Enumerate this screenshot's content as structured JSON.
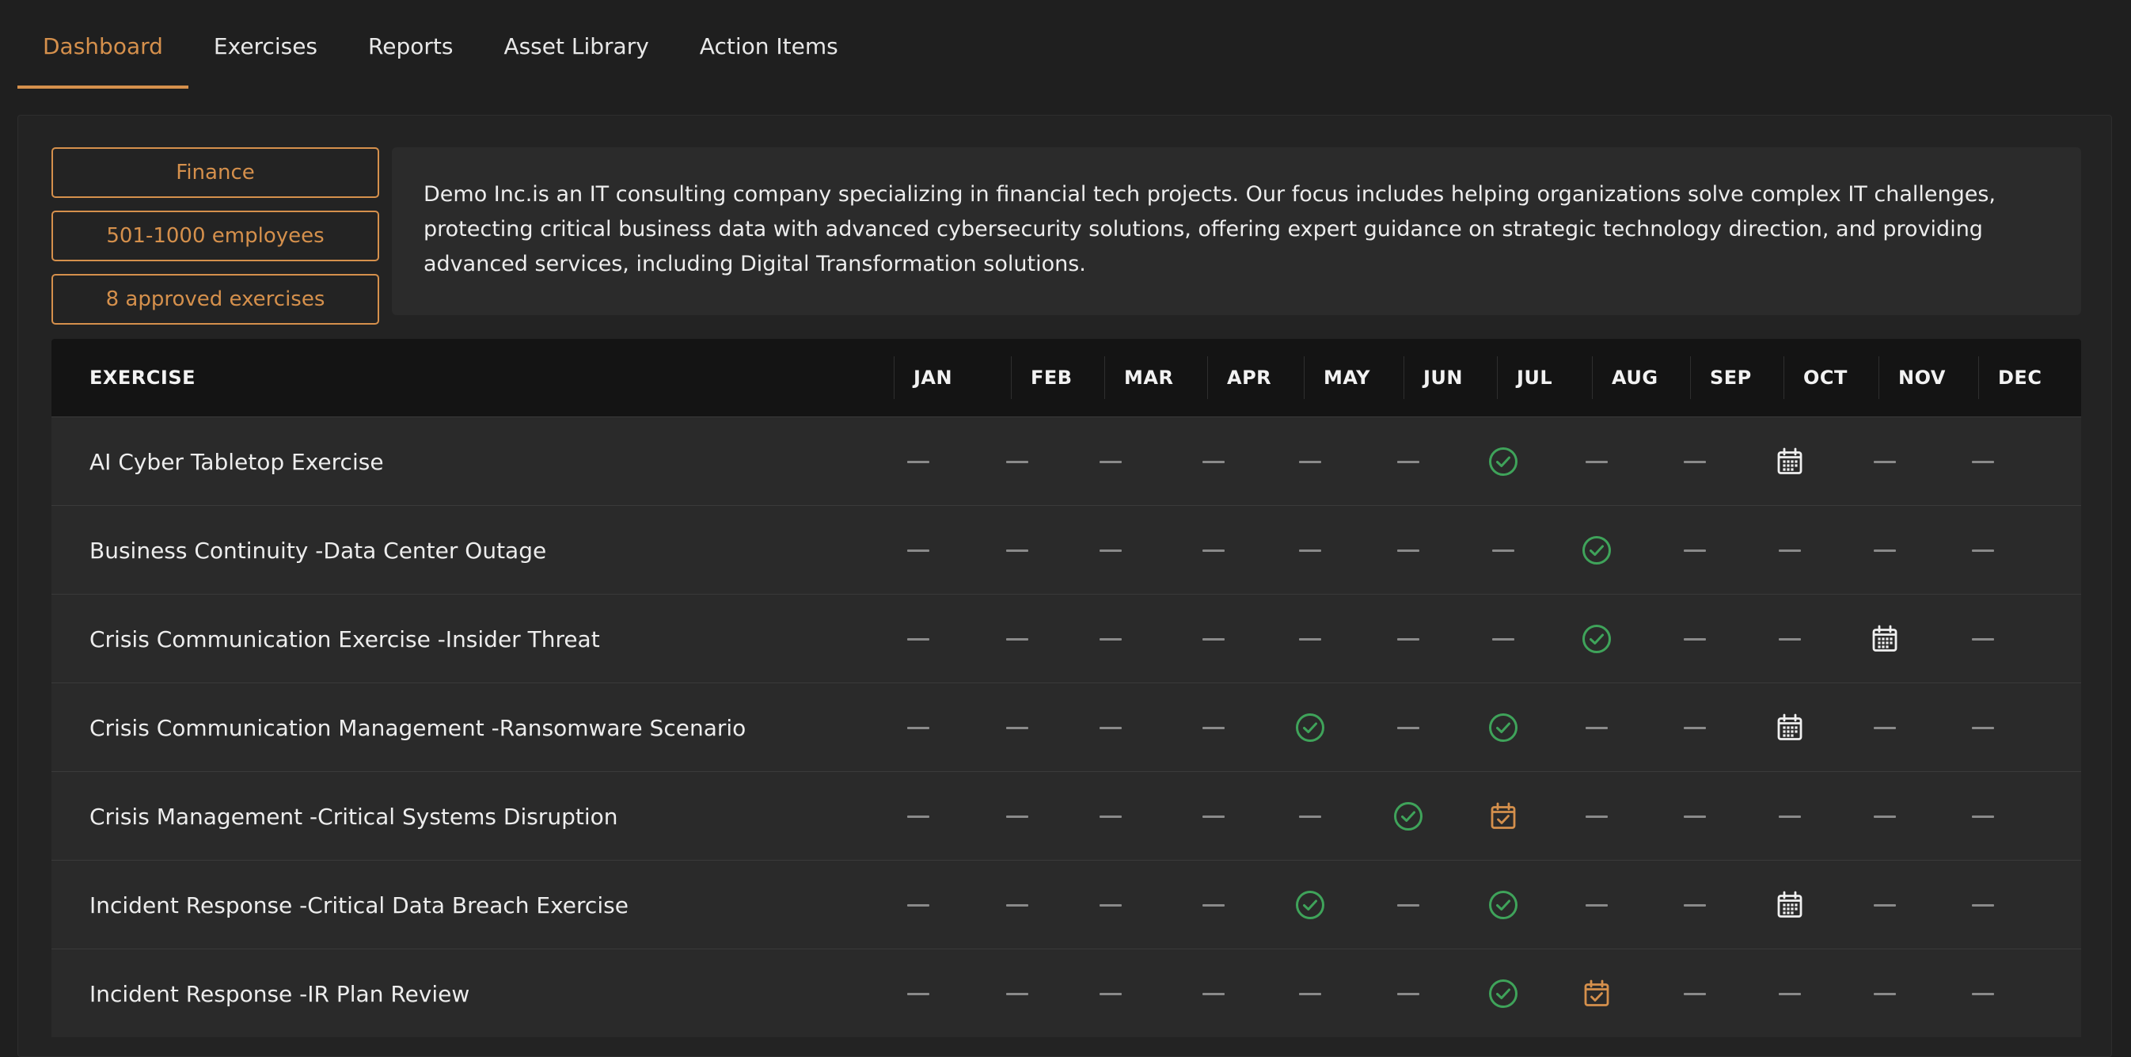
{
  "nav": {
    "tabs": [
      {
        "label": "Dashboard",
        "active": true
      },
      {
        "label": "Exercises",
        "active": false
      },
      {
        "label": "Reports",
        "active": false
      },
      {
        "label": "Asset Library",
        "active": false
      },
      {
        "label": "Action Items",
        "active": false
      }
    ]
  },
  "profile": {
    "tags": [
      "Finance",
      "501-1000 employees",
      "8 approved exercises"
    ],
    "about": "Demo Inc.is an IT consulting company specializing in financial tech projects. Our focus includes helping organizations solve complex IT challenges, protecting critical business data with advanced cybersecurity solutions, offering expert guidance on strategic technology direction, and providing advanced services, including Digital Transformation solutions."
  },
  "colors": {
    "accent": "#d5904c",
    "completed": "#3fa35a",
    "scheduled": "#f0f0f0",
    "dash": "#8a8a8a"
  },
  "table": {
    "header": "EXERCISE",
    "months": [
      "JAN",
      "FEB",
      "MAR",
      "APR",
      "MAY",
      "JUN",
      "JUL",
      "AUG",
      "SEP",
      "OCT",
      "NOV",
      "DEC"
    ],
    "status_legend": {
      "-": "none",
      "done": "check-circle-icon",
      "sched": "calendar-icon",
      "pending": "calendar-check-icon"
    },
    "rows": [
      {
        "name": "AI Cyber Tabletop Exercise",
        "status": [
          "-",
          "-",
          "-",
          "-",
          "-",
          "-",
          "done",
          "-",
          "-",
          "sched",
          "-",
          "-"
        ]
      },
      {
        "name": "Business Continuity -Data Center Outage",
        "status": [
          "-",
          "-",
          "-",
          "-",
          "-",
          "-",
          "-",
          "done",
          "-",
          "-",
          "-",
          "-"
        ]
      },
      {
        "name": "Crisis Communication Exercise -Insider Threat",
        "status": [
          "-",
          "-",
          "-",
          "-",
          "-",
          "-",
          "-",
          "done",
          "-",
          "-",
          "sched",
          "-"
        ]
      },
      {
        "name": "Crisis Communication Management -Ransomware Scenario",
        "status": [
          "-",
          "-",
          "-",
          "-",
          "done",
          "-",
          "done",
          "-",
          "-",
          "sched",
          "-",
          "-"
        ]
      },
      {
        "name": "Crisis Management -Critical Systems Disruption",
        "status": [
          "-",
          "-",
          "-",
          "-",
          "-",
          "done",
          "pending",
          "-",
          "-",
          "-",
          "-",
          "-"
        ]
      },
      {
        "name": "Incident Response -Critical Data Breach Exercise",
        "status": [
          "-",
          "-",
          "-",
          "-",
          "done",
          "-",
          "done",
          "-",
          "-",
          "sched",
          "-",
          "-"
        ]
      },
      {
        "name": "Incident Response -IR Plan Review",
        "status": [
          "-",
          "-",
          "-",
          "-",
          "-",
          "-",
          "done",
          "pending",
          "-",
          "-",
          "-",
          "-"
        ]
      }
    ]
  }
}
